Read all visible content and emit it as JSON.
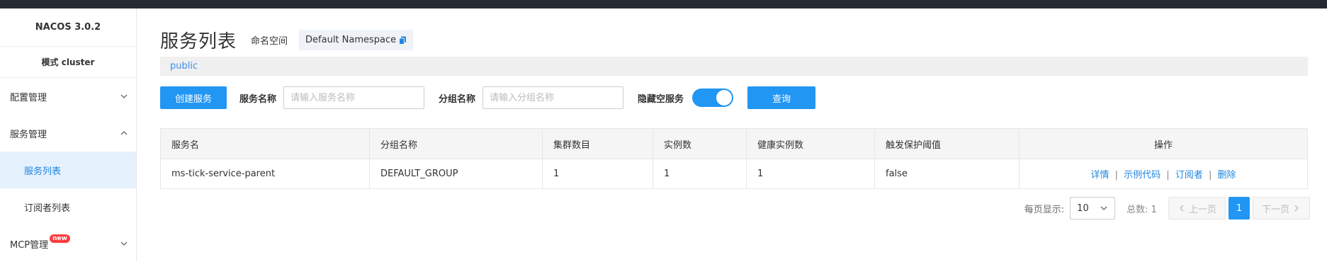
{
  "app": {
    "title": "NACOS 3.0.2",
    "mode": "模式 cluster"
  },
  "sidebar": {
    "items": [
      {
        "label": "配置管理"
      },
      {
        "label": "服务管理"
      },
      {
        "label": "服务列表"
      },
      {
        "label": "订阅者列表"
      },
      {
        "label": "MCP管理",
        "badge": "new"
      }
    ]
  },
  "header": {
    "title": "服务列表",
    "namespace_label": "命名空间",
    "namespace_value": "Default Namespace",
    "namespace_link": "public"
  },
  "filters": {
    "create_button": "创建服务",
    "service_name_label": "服务名称",
    "service_name_placeholder": "请输入服务名称",
    "group_name_label": "分组名称",
    "group_name_placeholder": "请输入分组名称",
    "hide_empty_label": "隐藏空服务",
    "hide_empty_on": true,
    "query_button": "查询"
  },
  "table": {
    "columns": [
      "服务名",
      "分组名称",
      "集群数目",
      "实例数",
      "健康实例数",
      "触发保护阈值",
      "操作"
    ],
    "rows": [
      [
        "ms-tick-service-parent",
        "DEFAULT_GROUP",
        "1",
        "1",
        "1",
        "false"
      ]
    ],
    "actions": [
      "详情",
      "示例代码",
      "订阅者",
      "删除"
    ],
    "action_separator": "|"
  },
  "pagination": {
    "page_size_label": "每页显示:",
    "page_size": "10",
    "total_label": "总数: 1",
    "prev_label": "上一页",
    "current_page": "1",
    "next_label": "下一页"
  },
  "colors": {
    "primary": "#2196f3",
    "link": "#1f86e0",
    "active_bg": "#e5f1fd",
    "topbar": "#252a30"
  }
}
